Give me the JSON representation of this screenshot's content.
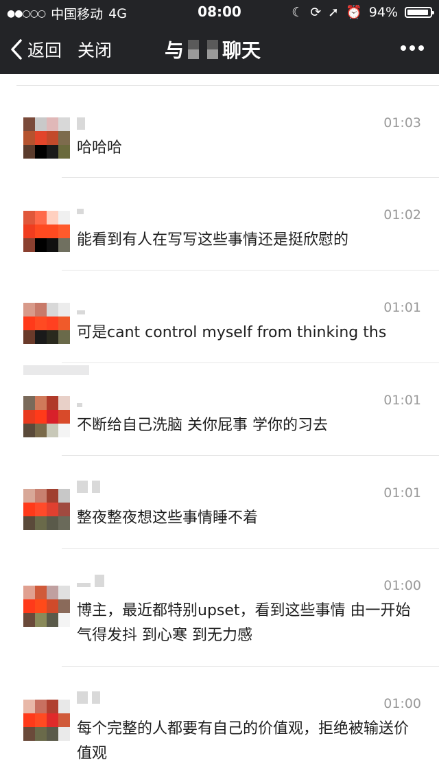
{
  "status_bar": {
    "carrier": "中国移动",
    "network": "4G",
    "time": "08:00",
    "battery": "94%",
    "signal_icon": "signal-dots-icon",
    "moon_icon": "moon-icon",
    "lock_icon": "rotation-lock-icon",
    "location_icon": "location-arrow-icon",
    "alarm_icon": "alarm-icon",
    "battery_level": 0.94
  },
  "nav": {
    "back_label": "返回",
    "close_label": "关闭",
    "title_prefix": "与",
    "title_suffix": "聊天",
    "more_icon": "more-dots-icon"
  },
  "messages": [
    {
      "time": "01:03",
      "text": "哈哈哈"
    },
    {
      "time": "01:02",
      "text": "能看到有人在写写这些事情还是挺欣慰的"
    },
    {
      "time": "01:01",
      "text": "可是cant control myself from thinking ths"
    },
    {
      "time": "01:01",
      "text": "不断给自己洗脑 关你屁事 学你的习去"
    },
    {
      "time": "01:01",
      "text": "整夜整夜想这些事情睡不着"
    },
    {
      "time": "01:00",
      "text": "博主，最近都特别upset，看到这些事情 由一开始气得发抖 到心寒 到无力感"
    },
    {
      "time": "01:00",
      "text": "每个完整的人都要有自己的价值观，拒绝被输送价值观"
    }
  ],
  "colors": {
    "header_bg": "#232427",
    "time_text": "#9a9a9a",
    "message_text": "#1e1e1e",
    "divider": "#e6e6e6"
  }
}
